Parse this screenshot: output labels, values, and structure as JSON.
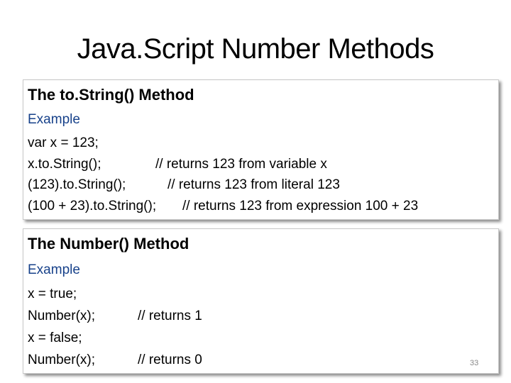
{
  "slide": {
    "title": "Java.Script Number Methods",
    "page_number": "33",
    "colors": {
      "example_label": "#17418a",
      "box_border": "#c8c8c8",
      "text": "#000000"
    }
  },
  "sections": [
    {
      "heading": "The to.String() Method",
      "example_label": "Example",
      "lines": [
        {
          "code": "var x = 123;",
          "comment": ""
        },
        {
          "code": "x.to.String();",
          "comment": "// returns 123 from variable x"
        },
        {
          "code": "(123).to.String();",
          "comment": "// returns 123 from literal 123"
        },
        {
          "code": "(100 + 23).to.String();",
          "comment": "// returns 123 from expression 100 + 23"
        }
      ]
    },
    {
      "heading": "The Number() Method",
      "example_label": "Example",
      "lines": [
        {
          "code": "x = true;",
          "comment": ""
        },
        {
          "code": "Number(x);",
          "comment": "// returns 1"
        },
        {
          "code": "x = false;",
          "comment": ""
        },
        {
          "code": "Number(x);",
          "comment": "// returns 0"
        }
      ]
    }
  ]
}
